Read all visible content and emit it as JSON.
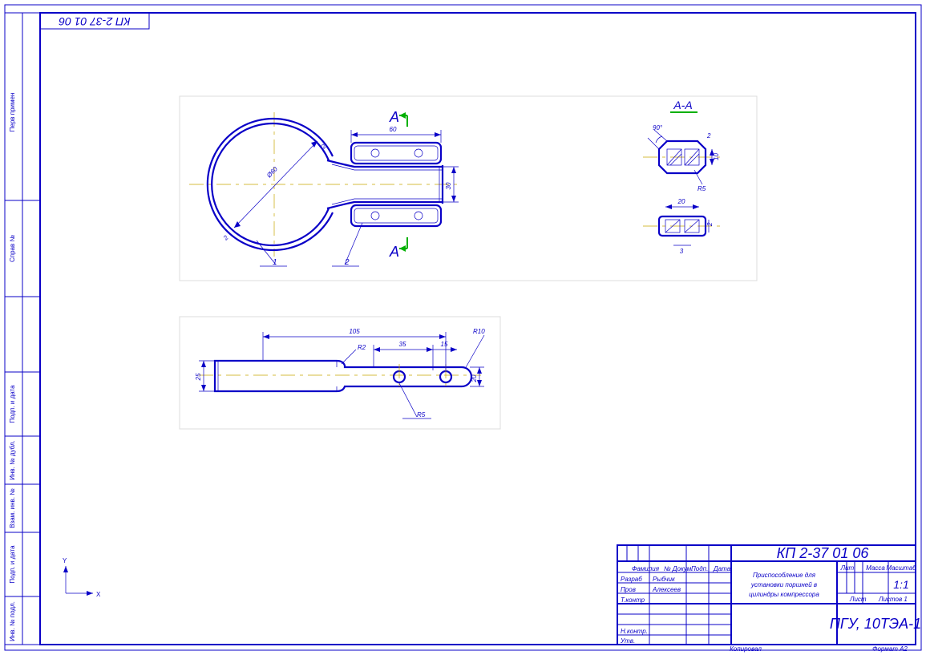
{
  "sheet": {
    "id": "КП 2-37 01 06",
    "id_mirrored": "КП 2-37 01 06",
    "format": "Формат  А2",
    "copied": "Копировал"
  },
  "title_block": {
    "title_line1": "Приспособление для",
    "title_line2": "установки поршней в",
    "title_line3": "цилиндры компрессора",
    "drawing_number": "КП 2-37 01 06",
    "org": "ПГУ, 10ТЭА-1",
    "rows": {
      "r1c1": "Фамилия",
      "r1c2": "№ Докум.",
      "r1c3": "Подп.",
      "r1c4": "Дата",
      "r2c1": "Разраб",
      "r2c1v": "Рыбчик",
      "r3c1": "Пров",
      "r3c1v": "Алексеев",
      "r4c1": "Т.контр",
      "r5c1": "",
      "r6c1": "Н.контр.",
      "r7c1": "Утв."
    },
    "right_box": {
      "h1": "Лит.",
      "h2": "Масса",
      "h3": "Масштаб",
      "mass": "",
      "scale": "1:1",
      "sheet_label": "Лист",
      "sheets_label": "Листов  1"
    }
  },
  "left_strip": {
    "cells": [
      "Инв. № подл.",
      "Подп. и дата",
      "Взам. инв. №",
      "Инв. № дубл.",
      "Подп. и дата",
      "Справ №",
      "Перв примен"
    ]
  },
  "annotations": {
    "section_marker_top": "А",
    "section_marker_bot": "А",
    "section_title": "А-А",
    "balloons": {
      "b1": "1",
      "b2": "2",
      "b3": "2"
    }
  },
  "dimensions": {
    "d60": "60",
    "d30": "30",
    "d20": "20",
    "dDia60": "Ø60",
    "d105": "105",
    "d35": "35",
    "d15": "15",
    "d25": "25",
    "d20b": "20",
    "r10": "R10",
    "r2": "R2",
    "r5": "R5",
    "r5b": "R5",
    "d90deg": "90°",
    "d10a": "10",
    "d20c": "20",
    "d2": "2",
    "d3": "3"
  },
  "axis_labels": {
    "x": "X",
    "y": "Y"
  }
}
